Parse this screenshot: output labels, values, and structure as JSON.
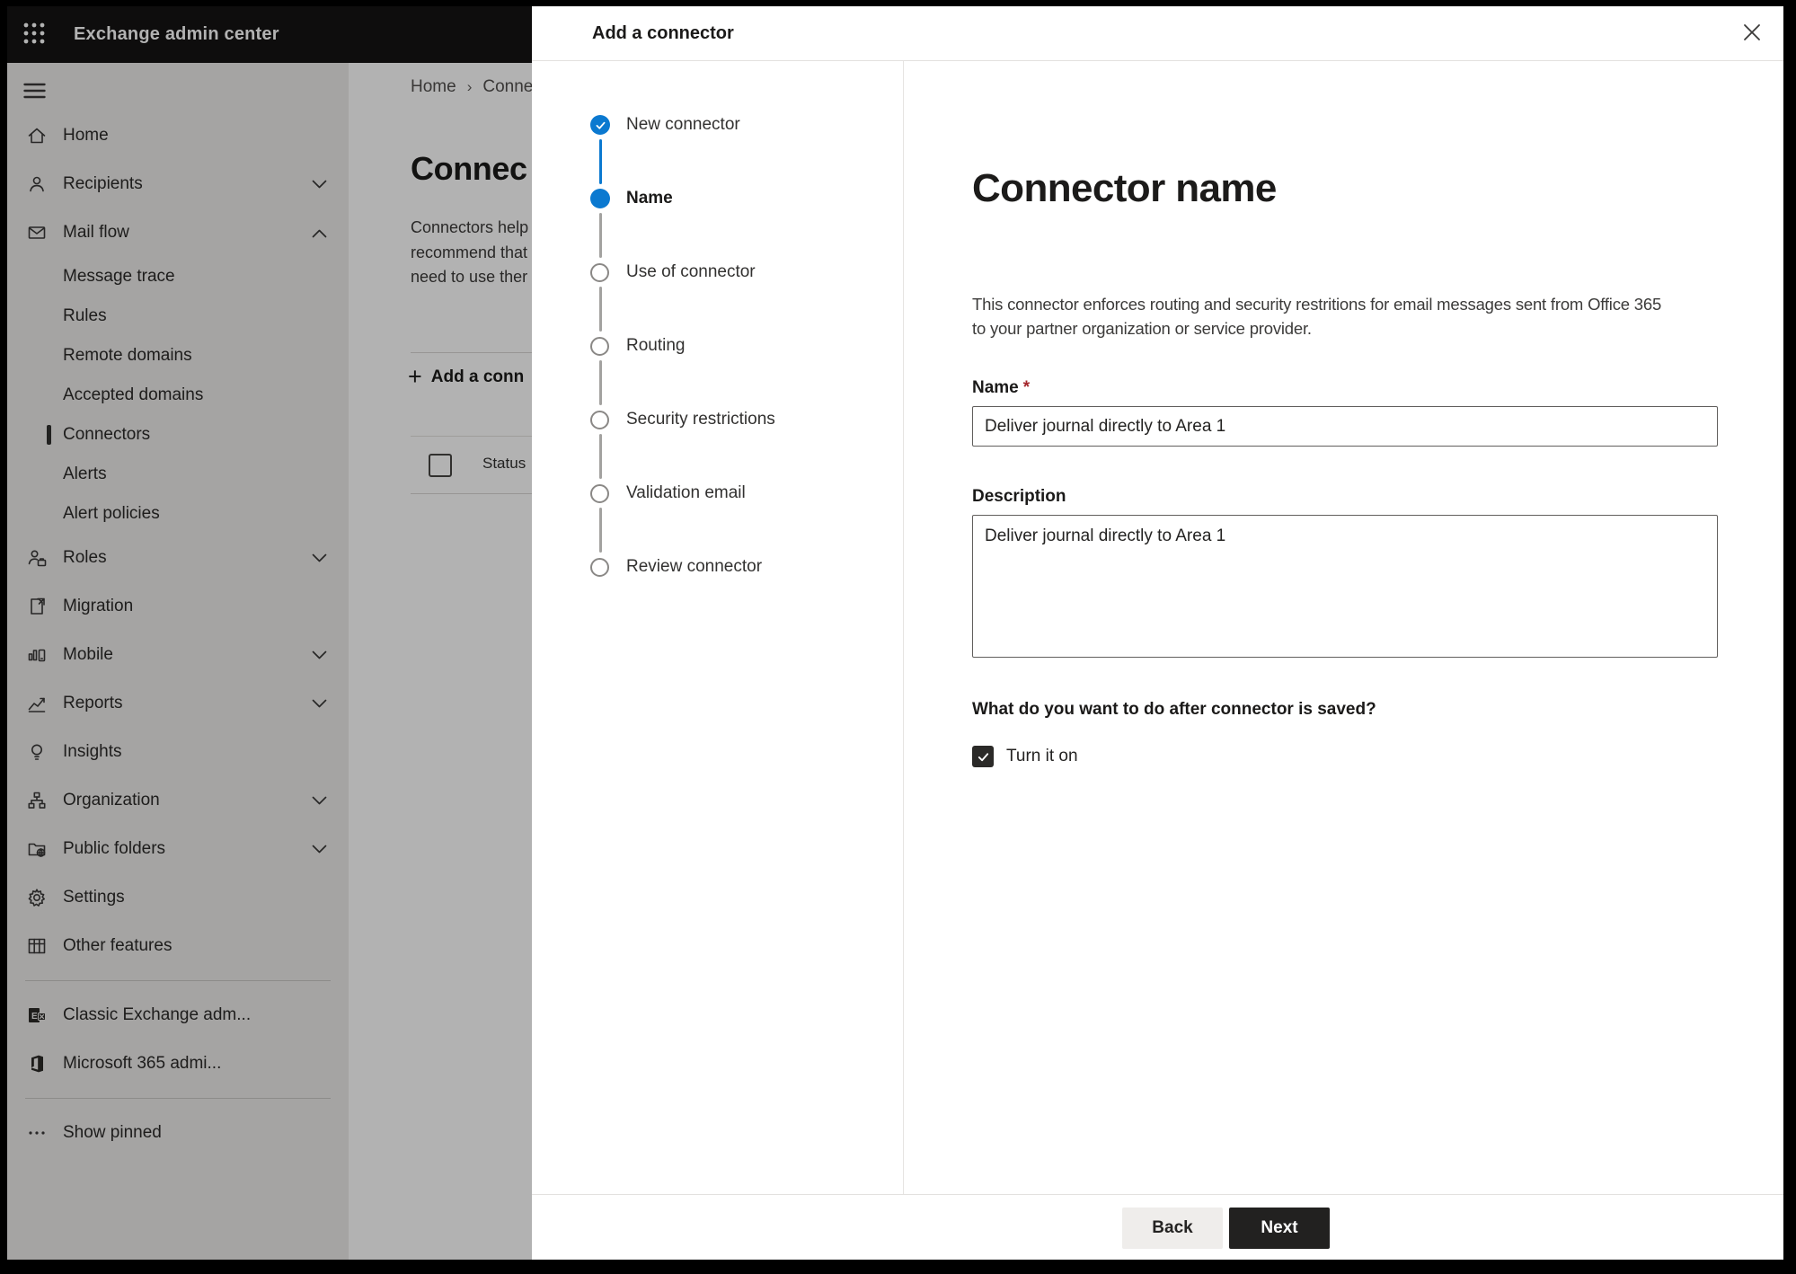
{
  "topbar": {
    "title": "Exchange admin center"
  },
  "sidebar": {
    "items": [
      {
        "id": "home",
        "label": "Home",
        "icon": "home-icon",
        "type": "top"
      },
      {
        "id": "recipients",
        "label": "Recipients",
        "icon": "person-icon",
        "type": "top",
        "chevron": "down"
      },
      {
        "id": "mail-flow",
        "label": "Mail flow",
        "icon": "mail-icon",
        "type": "top",
        "chevron": "up"
      },
      {
        "id": "message-trace",
        "label": "Message trace",
        "type": "sub"
      },
      {
        "id": "rules",
        "label": "Rules",
        "type": "sub"
      },
      {
        "id": "remote-domains",
        "label": "Remote domains",
        "type": "sub"
      },
      {
        "id": "accepted-domains",
        "label": "Accepted domains",
        "type": "sub"
      },
      {
        "id": "connectors",
        "label": "Connectors",
        "type": "sub",
        "selected": true
      },
      {
        "id": "alerts",
        "label": "Alerts",
        "type": "sub"
      },
      {
        "id": "alert-policies",
        "label": "Alert policies",
        "type": "sub"
      },
      {
        "id": "roles",
        "label": "Roles",
        "icon": "roles-icon",
        "type": "top",
        "chevron": "down"
      },
      {
        "id": "migration",
        "label": "Migration",
        "icon": "migration-icon",
        "type": "top"
      },
      {
        "id": "mobile",
        "label": "Mobile",
        "icon": "mobile-icon",
        "type": "top",
        "chevron": "down"
      },
      {
        "id": "reports",
        "label": "Reports",
        "icon": "reports-icon",
        "type": "top",
        "chevron": "down"
      },
      {
        "id": "insights",
        "label": "Insights",
        "icon": "insights-icon",
        "type": "top"
      },
      {
        "id": "organization",
        "label": "Organization",
        "icon": "organization-icon",
        "type": "top",
        "chevron": "down"
      },
      {
        "id": "public-folders",
        "label": "Public folders",
        "icon": "public-folders-icon",
        "type": "top",
        "chevron": "down"
      },
      {
        "id": "settings",
        "label": "Settings",
        "icon": "settings-icon",
        "type": "top"
      },
      {
        "id": "other-features",
        "label": "Other features",
        "icon": "other-features-icon",
        "type": "top"
      },
      {
        "type": "divider"
      },
      {
        "id": "classic-exchange",
        "label": "Classic Exchange adm...",
        "icon": "classic-exchange-icon",
        "type": "top"
      },
      {
        "id": "microsoft-365",
        "label": "Microsoft 365 admi...",
        "icon": "microsoft-365-icon",
        "type": "top"
      },
      {
        "type": "divider"
      },
      {
        "id": "show-pinned",
        "label": "Show pinned",
        "icon": "more-icon",
        "type": "top"
      }
    ]
  },
  "page": {
    "breadcrumb": {
      "home": "Home",
      "separator": "›",
      "current": "Conne"
    },
    "title": "Connec",
    "intro_lines": [
      "Connectors help",
      "recommend that",
      "need to use ther"
    ],
    "add_button": "Add a conn",
    "plus_glyph": "+",
    "table": {
      "status_header": "Status"
    }
  },
  "dialog": {
    "title": "Add a connector",
    "steps": [
      {
        "label": "New connector",
        "state": "completed"
      },
      {
        "label": "Name",
        "state": "current"
      },
      {
        "label": "Use of connector",
        "state": "upcoming"
      },
      {
        "label": "Routing",
        "state": "upcoming"
      },
      {
        "label": "Security restrictions",
        "state": "upcoming"
      },
      {
        "label": "Validation email",
        "state": "upcoming"
      },
      {
        "label": "Review connector",
        "state": "upcoming"
      }
    ],
    "content": {
      "heading": "Connector name",
      "description_lines": [
        "This connector enforces routing and security restritions for email messages sent from Office 365",
        "to your partner organization or service provider."
      ],
      "name_label": "Name",
      "required_mark": "*",
      "name_value": "Deliver journal directly to Area 1",
      "description_label": "Description",
      "description_value": "Deliver journal directly to Area 1",
      "after_save_question": "What do you want to do after connector is saved?",
      "turn_on": {
        "label": "Turn it on",
        "checked": true
      }
    },
    "footer": {
      "back": "Back",
      "next": "Next"
    }
  },
  "colors": {
    "accent_blue": "#0b79d0",
    "required_red": "#a4262c",
    "next_button": "#222120",
    "overlay": "rgba(0,0,0,0.30)"
  }
}
